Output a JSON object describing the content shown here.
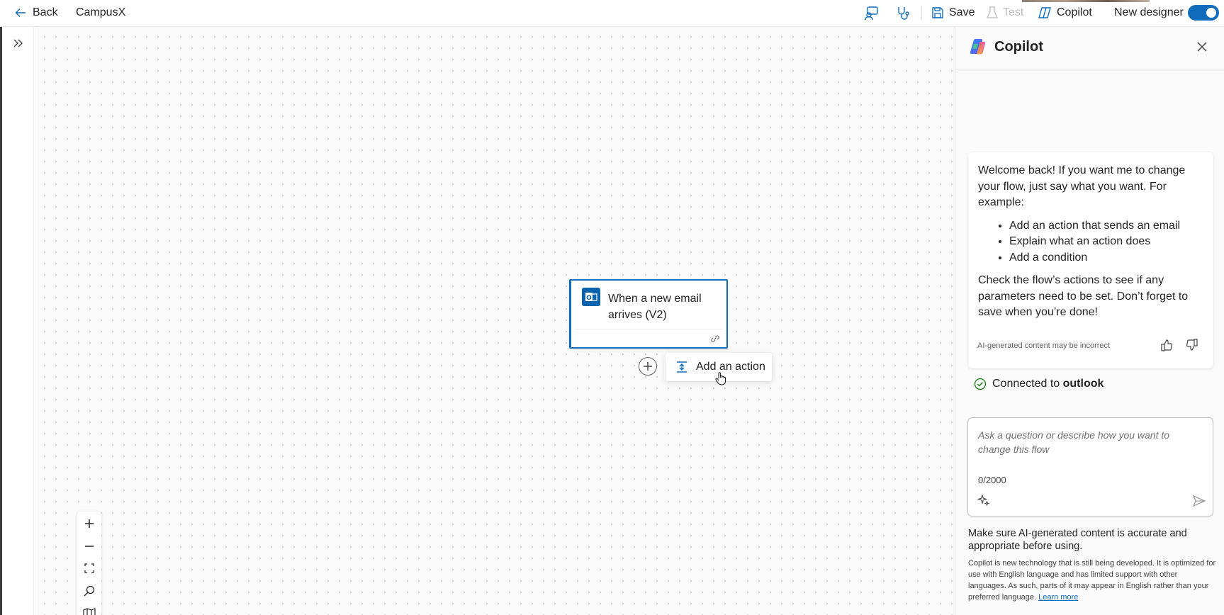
{
  "header": {
    "back_label": "Back",
    "flow_name": "CampusX",
    "save_label": "Save",
    "test_label": "Test",
    "copilot_label": "Copilot",
    "new_designer_label": "New designer",
    "new_designer_enabled": true,
    "accent_color": "#0f6cbd"
  },
  "canvas": {
    "trigger": {
      "title": "When a new email arrives (V2)",
      "icon": "outlook-icon"
    },
    "add_action_label": "Add an action",
    "zoom_controls": [
      "zoom-in-icon",
      "zoom-out-icon",
      "fit-view-icon",
      "search-icon",
      "minimap-icon"
    ]
  },
  "copilot": {
    "title": "Copilot",
    "message": {
      "intro": "Welcome back! If you want me to change your flow, just say what you want. For example:",
      "examples": [
        "Add an action that sends an email",
        "Explain what an action does",
        "Add a condition"
      ],
      "outro": "Check the flow’s actions to see if any parameters need to be set. Don’t forget to save when you’re done!",
      "disclaimer": "AI-generated content may be incorrect"
    },
    "connection": {
      "prefix": "Connected to ",
      "service": "outlook"
    },
    "input": {
      "placeholder": "Ask a question or describe how you want to change this flow",
      "char_count": "0/2000"
    },
    "note_main": "Make sure AI-generated content is accurate and appropriate before using.",
    "note_small": "Copilot is new technology that is still being developed. It is optimized for use with English language and has limited support with other languages. As such, parts of it may appear in English rather than your preferred language.",
    "learn_more": "Learn more"
  }
}
